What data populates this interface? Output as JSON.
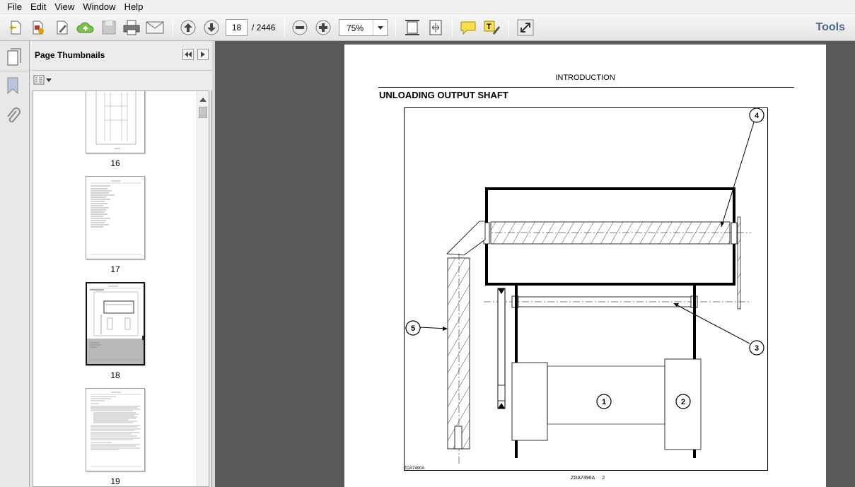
{
  "menu": [
    "File",
    "Edit",
    "View",
    "Window",
    "Help"
  ],
  "toolbar": {
    "current_page": "18",
    "total_pages": "/  2446",
    "zoom": "75%",
    "tools_label": "Tools",
    "icons": [
      "create-pdf-icon",
      "create-from-file-icon",
      "edit-icon",
      "upload-cloud-icon",
      "save-icon",
      "print-icon",
      "email-icon",
      "previous-page-icon",
      "next-page-icon",
      "zoom-out-icon",
      "zoom-in-icon",
      "fit-page-icon",
      "fit-width-icon",
      "comment-icon",
      "highlight-icon",
      "fullscreen-icon"
    ]
  },
  "sidebar": {
    "title": "Page Thumbnails",
    "thumbnails": [
      {
        "label": "16"
      },
      {
        "label": "17"
      },
      {
        "label": "18",
        "selected": true
      },
      {
        "label": "19"
      }
    ]
  },
  "document": {
    "header": "INTRODUCTION",
    "title": "UNLOADING OUTPUT SHAFT",
    "figure_code": "ZDA7490A",
    "footer_code": "ZDA7490A",
    "footer_page": "2",
    "callouts": [
      "1",
      "2",
      "3",
      "4",
      "5"
    ]
  }
}
